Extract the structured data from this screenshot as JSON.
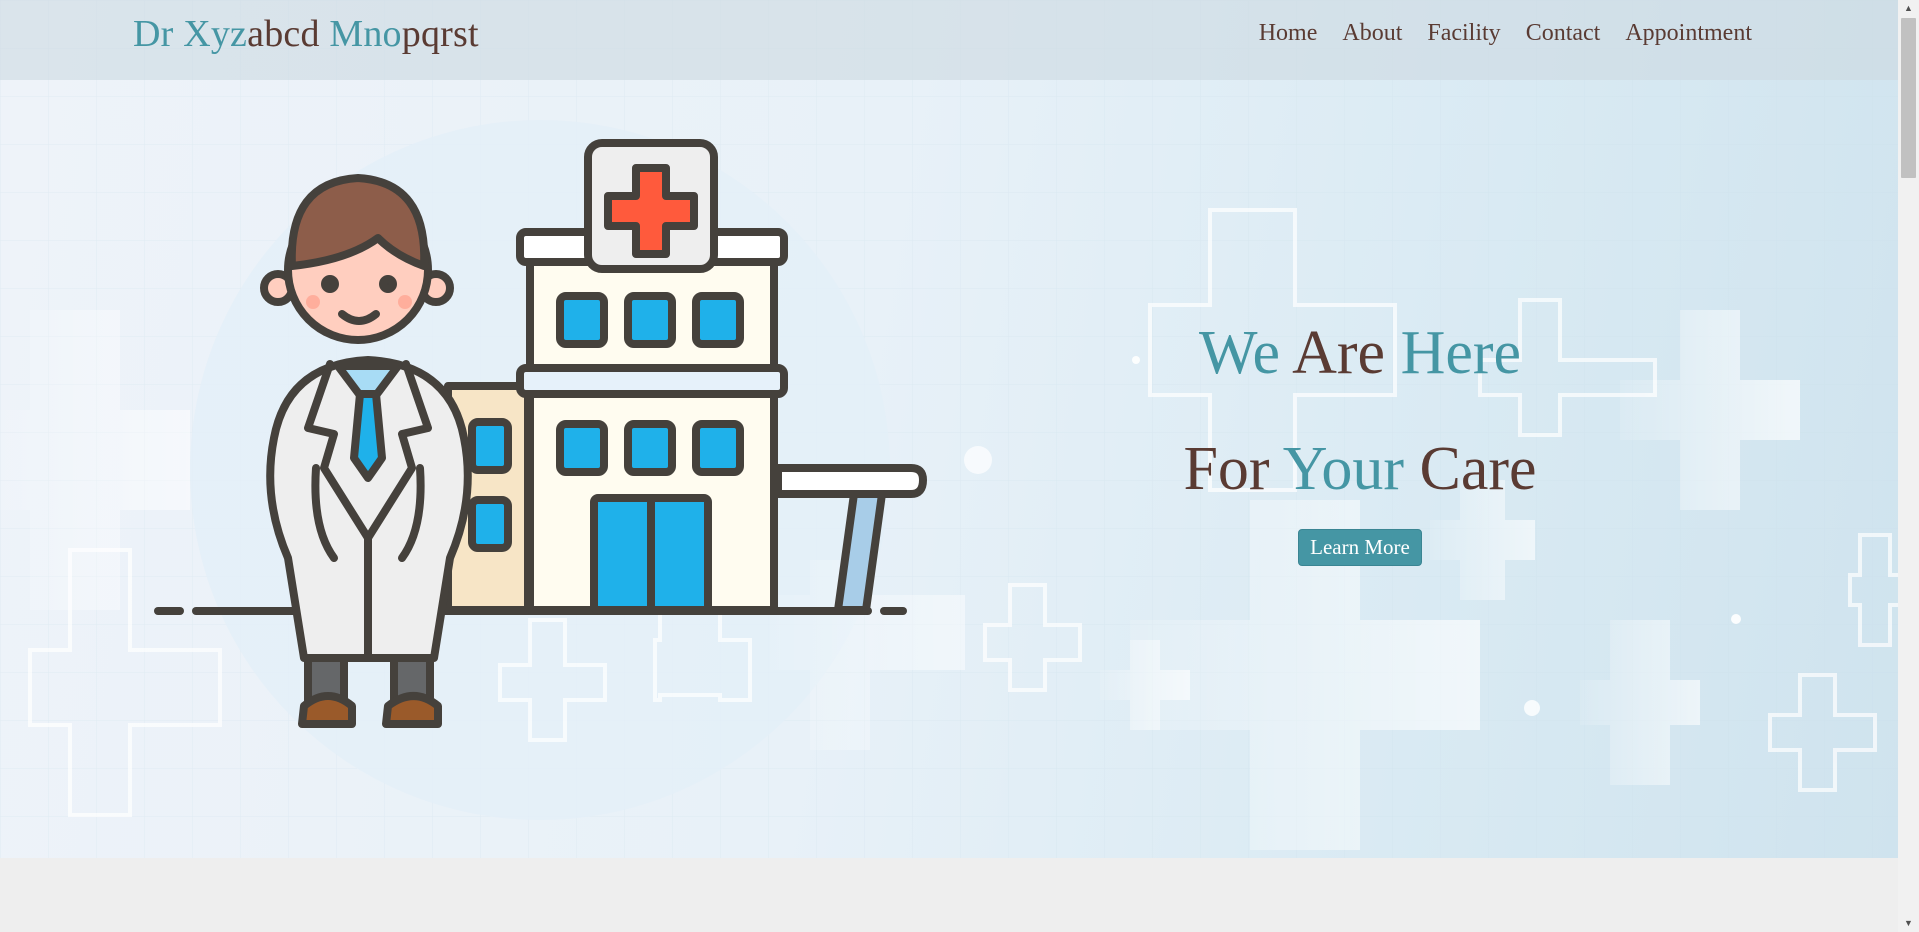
{
  "brand": {
    "part1": "Dr ",
    "part2": "Xyz",
    "part3": "abcd ",
    "part4": "Mno",
    "part5": "pqrst"
  },
  "nav": {
    "items": [
      "Home",
      "About",
      "Facility",
      "Contact",
      "Appointment"
    ]
  },
  "hero": {
    "line1_a": "We ",
    "line1_b": "Are ",
    "line1_c": "Here",
    "line2_a": "For ",
    "line2_b": "Your ",
    "line2_c": "Care",
    "button_label": "Learn More"
  },
  "colors": {
    "accent": "#4596a4",
    "text": "#5a3b33",
    "cross_red": "#ff5a3c",
    "window_blue": "#1fb1ea"
  },
  "icons": {
    "illustration": "doctor-and-hospital-illustration"
  }
}
